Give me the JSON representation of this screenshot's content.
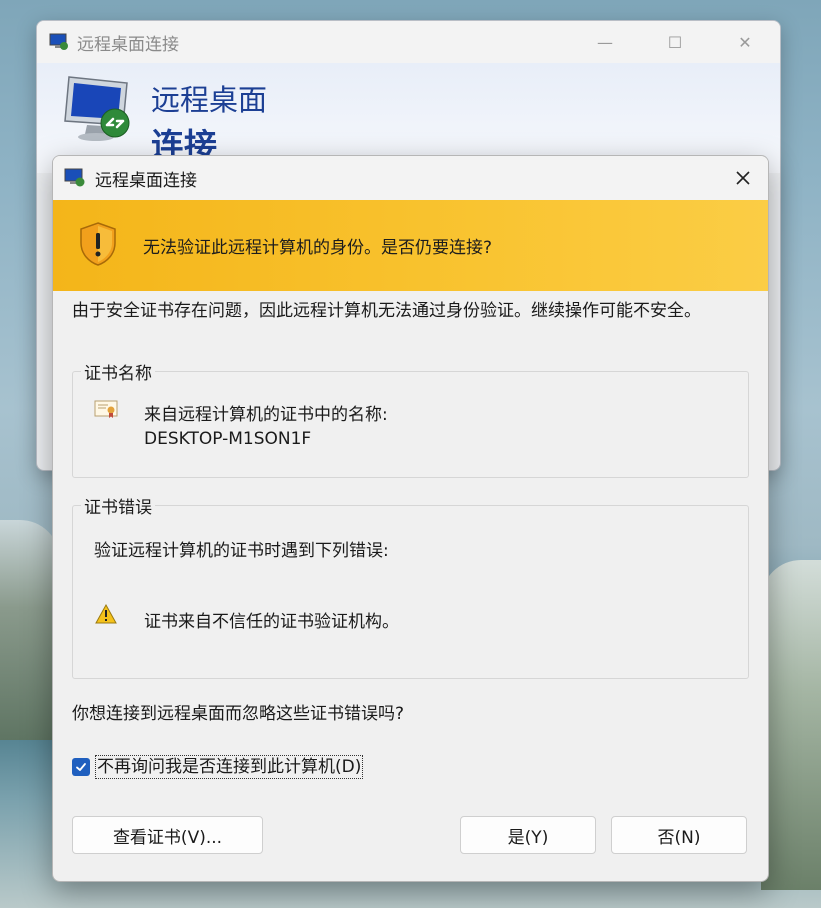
{
  "background_window": {
    "title": "远程桌面连接",
    "header_line1": "远程桌面",
    "header_line2": "连接"
  },
  "dialog": {
    "title": "远程桌面连接",
    "banner_text": "无法验证此远程计算机的身份。是否仍要连接?",
    "intro_text": "由于安全证书存在问题，因此远程计算机无法通过身份验证。继续操作可能不安全。",
    "cert_name_group": {
      "label": "证书名称",
      "line1": "来自远程计算机的证书中的名称:",
      "line2": "DESKTOP-M1SON1F"
    },
    "cert_error_group": {
      "label": "证书错误",
      "line1": "验证远程计算机的证书时遇到下列错误:",
      "error_item": "证书来自不信任的证书验证机构。"
    },
    "question": "你想连接到远程桌面而忽略这些证书错误吗?",
    "checkbox": {
      "label": "不再询问我是否连接到此计算机(D)",
      "checked": true
    },
    "buttons": {
      "view_cert": "查看证书(V)...",
      "yes": "是(Y)",
      "no": "否(N)"
    }
  },
  "colors": {
    "banner": "#f4b519",
    "accent": "#1f5fbf",
    "header_text": "#1c3f94"
  }
}
